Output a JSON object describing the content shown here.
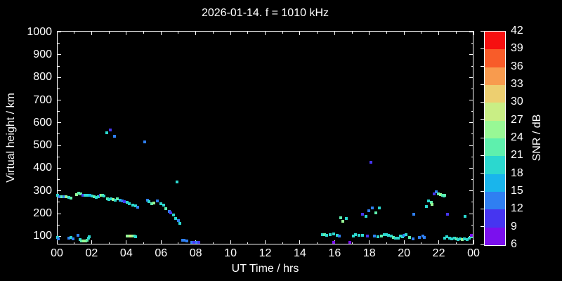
{
  "title": "2026-01-14. f = 1010 kHz",
  "axes": {
    "x_label": "UT Time / hrs",
    "y_label": "Virtual height / km",
    "x_tick_labels": [
      "00",
      "02",
      "04",
      "06",
      "08",
      "10",
      "12",
      "14",
      "16",
      "18",
      "20",
      "22",
      "00"
    ],
    "y_tick_labels": [
      "100",
      "200",
      "300",
      "400",
      "500",
      "600",
      "700",
      "800",
      "900",
      "1000"
    ]
  },
  "colorbar": {
    "label": "SNR / dB",
    "tick_labels": [
      "6",
      "9",
      "12",
      "15",
      "18",
      "21",
      "24",
      "27",
      "30",
      "33",
      "36",
      "39",
      "42"
    ],
    "segment_colors_bottom_to_top": [
      "#7b10ee",
      "#4635f0",
      "#2f7ff2",
      "#19b5ec",
      "#2bd8cf",
      "#5ef0ad",
      "#98f895",
      "#c9ee85",
      "#edcf70",
      "#f89b4e",
      "#f85c29",
      "#f61010"
    ]
  },
  "chart_data": {
    "type": "scatter",
    "title": "2026-01-14. f = 1010 kHz",
    "xlabel": "UT Time / hrs",
    "ylabel": "Virtual height / km",
    "colorbar_label": "SNR / dB",
    "xlim": [
      0,
      24
    ],
    "ylim": [
      64,
      1005
    ],
    "snr_range_db": [
      6,
      42
    ],
    "background": "#000000",
    "grid": false,
    "point_format": [
      "ut_hours",
      "virtual_height_km",
      "snr_db"
    ],
    "points": [
      [
        0.06,
        280,
        18
      ],
      [
        0.16,
        276,
        13
      ],
      [
        0.27,
        275,
        21
      ],
      [
        0.4,
        273,
        13
      ],
      [
        0.51,
        276,
        24
      ],
      [
        0.67,
        272,
        18
      ],
      [
        0.81,
        268,
        21
      ],
      [
        1.15,
        285,
        25
      ],
      [
        1.25,
        290,
        22
      ],
      [
        1.37,
        287,
        22
      ],
      [
        1.48,
        282,
        10
      ],
      [
        1.62,
        280,
        18
      ],
      [
        1.75,
        280,
        18
      ],
      [
        1.89,
        280,
        16
      ],
      [
        2.02,
        278,
        18
      ],
      [
        2.16,
        275,
        22
      ],
      [
        2.26,
        272,
        18
      ],
      [
        2.4,
        275,
        18
      ],
      [
        2.5,
        280,
        10
      ],
      [
        2.56,
        281,
        24
      ],
      [
        2.63,
        282,
        22
      ],
      [
        2.7,
        278,
        18
      ],
      [
        2.89,
        557,
        19
      ],
      [
        3.09,
        570,
        10
      ],
      [
        3.32,
        541,
        13
      ],
      [
        2.9,
        264,
        22
      ],
      [
        3.0,
        261,
        18
      ],
      [
        3.1,
        264,
        18
      ],
      [
        3.23,
        261,
        24
      ],
      [
        3.34,
        259,
        18
      ],
      [
        3.5,
        264,
        22
      ],
      [
        3.64,
        259,
        16
      ],
      [
        3.78,
        257,
        13
      ],
      [
        3.9,
        254,
        10
      ],
      [
        4.05,
        249,
        18
      ],
      [
        4.18,
        243,
        18
      ],
      [
        4.38,
        238,
        18
      ],
      [
        4.52,
        233,
        18
      ],
      [
        4.65,
        228,
        13
      ],
      [
        5.07,
        515,
        13
      ],
      [
        5.21,
        259,
        13
      ],
      [
        5.3,
        252,
        18
      ],
      [
        5.45,
        242,
        22
      ],
      [
        5.6,
        248,
        25
      ],
      [
        5.8,
        256,
        13
      ],
      [
        5.98,
        244,
        18
      ],
      [
        6.15,
        236,
        18
      ],
      [
        6.29,
        223,
        22
      ],
      [
        6.47,
        211,
        13
      ],
      [
        6.56,
        203,
        10
      ],
      [
        6.72,
        194,
        18
      ],
      [
        6.83,
        180,
        18
      ],
      [
        7.0,
        170,
        13
      ],
      [
        7.1,
        156,
        18
      ],
      [
        6.92,
        338,
        18
      ],
      [
        0.06,
        96,
        18
      ],
      [
        0.08,
        88,
        13
      ],
      [
        0.67,
        93,
        13
      ],
      [
        0.81,
        96,
        18
      ],
      [
        0.92,
        90,
        13
      ],
      [
        1.21,
        105,
        13
      ],
      [
        1.32,
        85,
        18
      ],
      [
        1.41,
        80,
        22
      ],
      [
        1.55,
        78,
        25
      ],
      [
        1.65,
        78,
        25
      ],
      [
        1.75,
        84,
        22
      ],
      [
        1.82,
        91,
        18
      ],
      [
        1.86,
        99,
        18
      ],
      [
        4.06,
        100,
        26
      ],
      [
        4.16,
        101,
        26
      ],
      [
        4.26,
        101,
        27
      ],
      [
        4.36,
        100,
        24
      ],
      [
        4.46,
        100,
        22
      ],
      [
        4.53,
        99,
        19
      ],
      [
        7.26,
        84,
        13
      ],
      [
        7.33,
        82,
        13
      ],
      [
        7.5,
        78,
        13
      ],
      [
        7.77,
        71,
        12
      ],
      [
        7.9,
        69,
        10
      ],
      [
        8.05,
        70,
        13
      ],
      [
        8.17,
        67,
        10
      ],
      [
        15.3,
        107,
        18
      ],
      [
        15.4,
        108,
        22
      ],
      [
        15.53,
        105,
        18
      ],
      [
        15.73,
        108,
        18
      ],
      [
        15.94,
        110,
        18
      ],
      [
        16.14,
        105,
        18
      ],
      [
        16.27,
        102,
        13
      ],
      [
        15.94,
        68,
        8
      ],
      [
        16.88,
        66,
        8
      ],
      [
        16.34,
        182,
        22
      ],
      [
        16.48,
        167,
        25
      ],
      [
        16.68,
        177,
        18
      ],
      [
        17.62,
        198,
        10
      ],
      [
        17.82,
        187,
        18
      ],
      [
        17.96,
        213,
        13
      ],
      [
        18.16,
        224,
        13
      ],
      [
        18.36,
        202,
        21
      ],
      [
        18.57,
        226,
        18
      ],
      [
        18.09,
        425,
        10
      ],
      [
        17.08,
        102,
        18
      ],
      [
        17.22,
        107,
        18
      ],
      [
        17.42,
        105,
        18
      ],
      [
        17.62,
        105,
        18
      ],
      [
        17.89,
        102,
        10
      ],
      [
        18.3,
        100,
        13
      ],
      [
        18.5,
        98,
        18
      ],
      [
        18.7,
        102,
        21
      ],
      [
        18.84,
        107,
        18
      ],
      [
        18.97,
        108,
        18
      ],
      [
        19.11,
        105,
        18
      ],
      [
        19.25,
        100,
        18
      ],
      [
        19.38,
        95,
        22
      ],
      [
        19.52,
        92,
        18
      ],
      [
        19.65,
        92,
        18
      ],
      [
        19.8,
        102,
        18
      ],
      [
        19.9,
        97,
        18
      ],
      [
        20.0,
        105,
        13
      ],
      [
        20.12,
        107,
        18
      ],
      [
        20.3,
        95,
        22
      ],
      [
        20.5,
        89,
        13
      ],
      [
        20.9,
        95,
        13
      ],
      [
        21.07,
        100,
        13
      ],
      [
        21.18,
        95,
        13
      ],
      [
        20.55,
        196,
        13
      ],
      [
        22.52,
        198,
        10
      ],
      [
        23.52,
        188,
        18
      ],
      [
        21.3,
        230,
        18
      ],
      [
        21.4,
        257,
        18
      ],
      [
        21.58,
        249,
        22
      ],
      [
        21.62,
        241,
        24
      ],
      [
        21.74,
        288,
        10
      ],
      [
        21.87,
        296,
        13
      ],
      [
        21.98,
        288,
        21
      ],
      [
        22.08,
        285,
        24
      ],
      [
        22.21,
        282,
        21
      ],
      [
        22.28,
        278,
        18
      ],
      [
        22.35,
        280,
        22
      ],
      [
        22.35,
        93,
        18
      ],
      [
        22.48,
        97,
        18
      ],
      [
        22.62,
        93,
        18
      ],
      [
        22.75,
        90,
        18
      ],
      [
        22.89,
        93,
        18
      ],
      [
        23.02,
        89,
        22
      ],
      [
        23.11,
        86,
        18
      ],
      [
        23.25,
        90,
        18
      ],
      [
        23.36,
        86,
        26
      ],
      [
        23.49,
        89,
        18
      ],
      [
        23.63,
        86,
        18
      ],
      [
        23.76,
        93,
        18
      ],
      [
        23.87,
        97,
        22
      ],
      [
        23.96,
        100,
        18
      ],
      [
        23.99,
        105,
        8
      ]
    ]
  }
}
